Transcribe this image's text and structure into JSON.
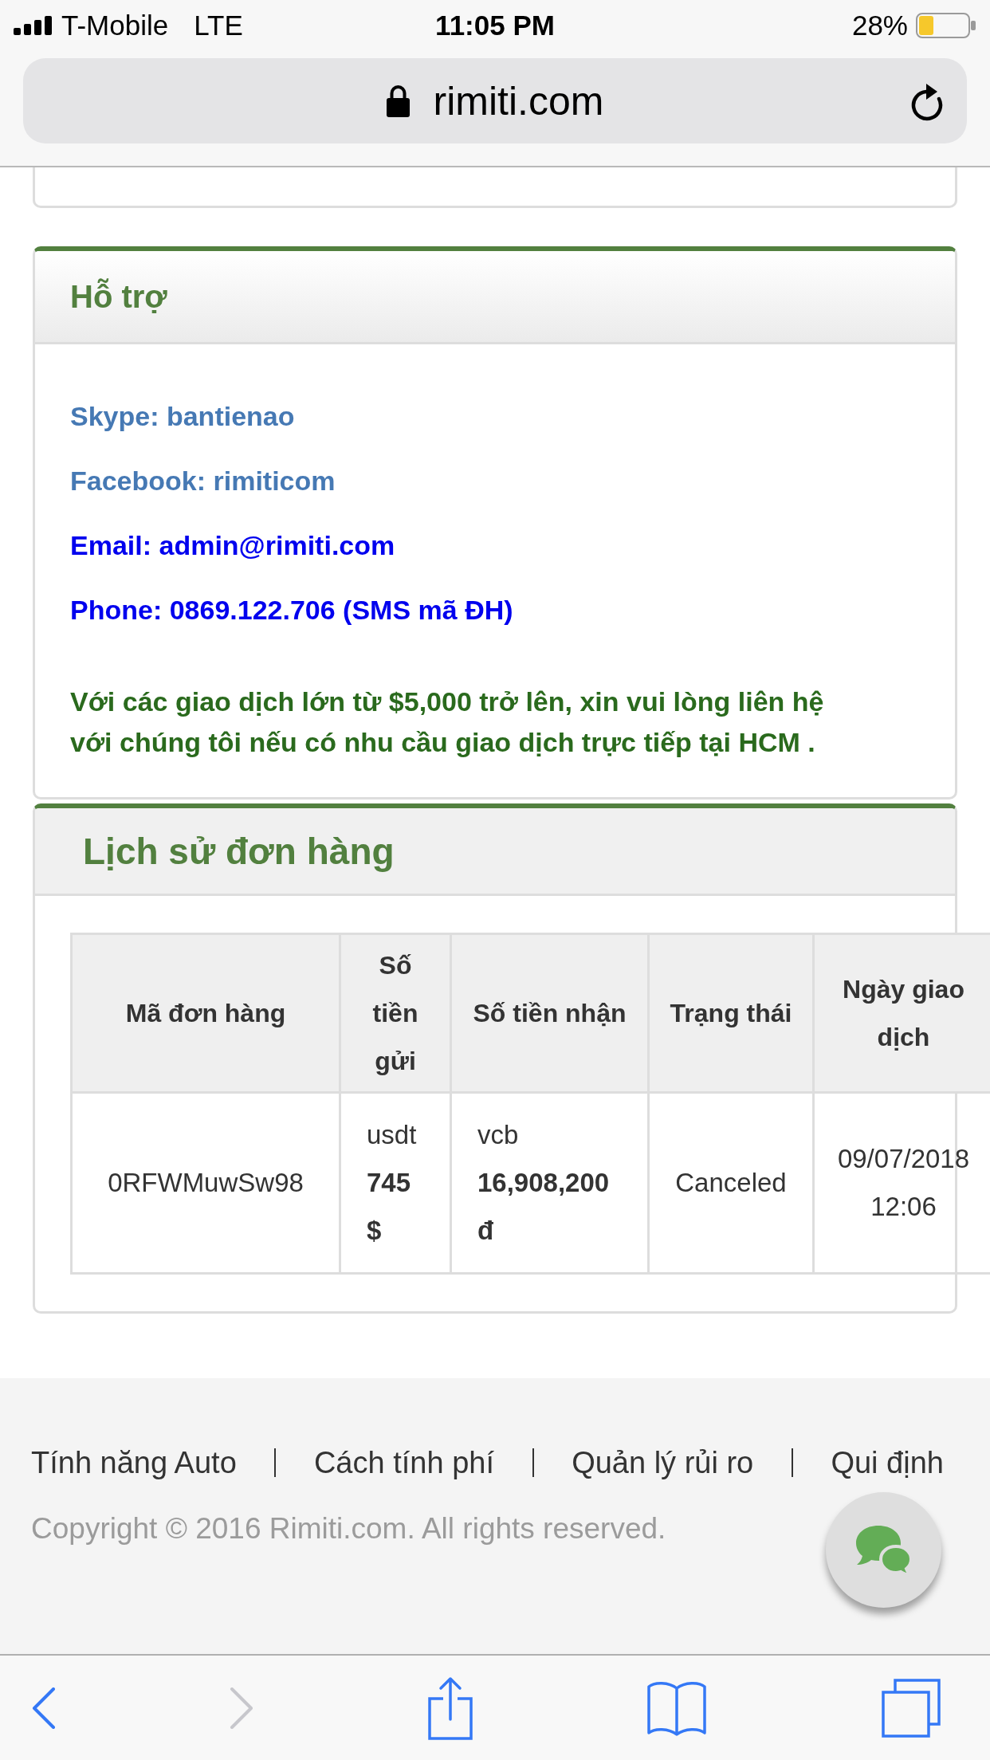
{
  "status_bar": {
    "carrier": "T-Mobile",
    "network": "LTE",
    "time": "11:05 PM",
    "battery": "28%"
  },
  "address_bar": {
    "url": "rimiti.com",
    "secure": true
  },
  "support": {
    "title": "Hỗ trợ",
    "contacts": [
      {
        "kind": "account",
        "text": "Skype: bantienao"
      },
      {
        "kind": "account",
        "text": "Facebook: rimiticom"
      },
      {
        "kind": "direct",
        "text": "Email: admin@rimiti.com"
      },
      {
        "kind": "direct",
        "text": "Phone: 0869.122.706 (SMS mã ĐH)"
      }
    ],
    "note": "Với các giao dịch lớn từ $5,000 trở lên, xin vui lòng liên hệ với chúng tôi nếu có nhu cầu giao dịch trực tiếp tại HCM ."
  },
  "order_history": {
    "title": "Lịch sử đơn hàng",
    "table": {
      "columns": [
        "Mã đơn hàng",
        "Số tiền gửi",
        "Số tiền nhận",
        "Trạng thái",
        "Ngày giao dịch"
      ],
      "rows": [
        {
          "order_id": "0RFWMuwSw98",
          "sent": {
            "method": "usdt",
            "amount": "745",
            "unit": "$"
          },
          "received": {
            "method": "vcb",
            "amount": "16,908,200",
            "unit": "đ"
          },
          "status": "Canceled",
          "date": "09/07/2018",
          "time": "12:06"
        }
      ]
    }
  },
  "footer": {
    "links": [
      "Tính năng Auto",
      "Cách tính phí",
      "Quản lý rủi ro",
      "Qui định"
    ],
    "copyright": "Copyright © 2016 Rimiti.com. All rights reserved."
  },
  "toolbar": {
    "buttons": [
      {
        "kind": "back",
        "disabled": false
      },
      {
        "kind": "forward",
        "disabled": true
      },
      {
        "kind": "share",
        "disabled": false
      },
      {
        "kind": "bookmarks",
        "disabled": false
      },
      {
        "kind": "tabs",
        "disabled": false
      }
    ]
  }
}
